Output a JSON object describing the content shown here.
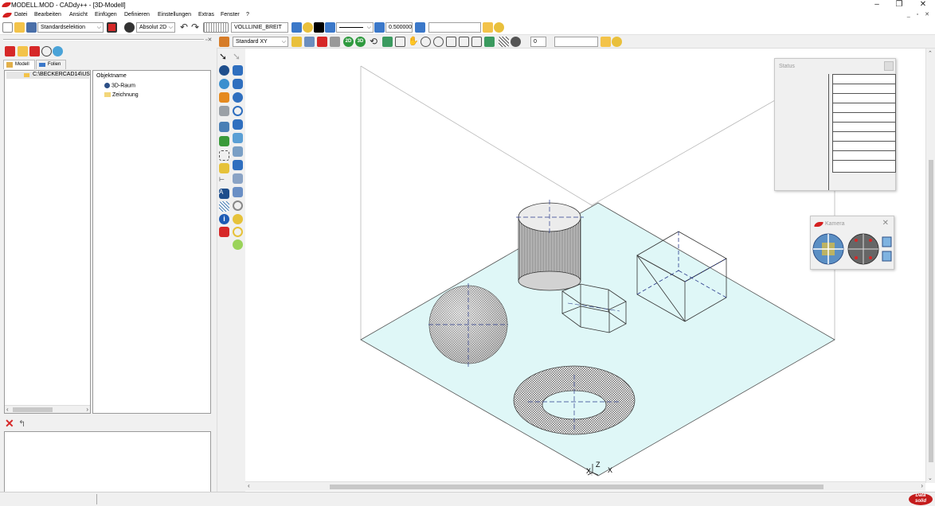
{
  "window": {
    "title": "MODELL.MOD - CADdy++ - [3D-Modell]",
    "controls": [
      "–",
      "❐",
      "✕"
    ],
    "mdi_controls": "_ ▫ ✕"
  },
  "menu": [
    "Datei",
    "Bearbeiten",
    "Ansicht",
    "Einfügen",
    "Definieren",
    "Einstellungen",
    "Extras",
    "Fenster",
    "?"
  ],
  "toolbar": {
    "selection_mode": "Standardselektion",
    "coord_mode": "Absolut 2D",
    "line_type": "VOLLLINIE_BREIT",
    "line_width": "0.500000",
    "extra_field": "",
    "view_mode": "Standard XY",
    "btn_2d": "2D",
    "btn_3d": "3D",
    "num_field": "0",
    "text_field": ""
  },
  "left_panel": {
    "tabs": [
      "Modell",
      "Folien"
    ],
    "path": "C:\\BECKERCAD14\\US",
    "object_header": "Objektname",
    "objects": [
      "3D-Raum",
      "Zeichnung"
    ]
  },
  "status_panel": {
    "title": "Status"
  },
  "kamera_panel": {
    "title": "Kamera"
  },
  "viewport": {
    "axis_x": "X",
    "axis_z": "Z",
    "axis_x2": "X"
  },
  "brand": {
    "line1": "Data",
    "line2": "solid"
  },
  "colors": {
    "accent_red": "#d42020",
    "plane_fill": "#dff7f7",
    "wire": "#444444"
  }
}
